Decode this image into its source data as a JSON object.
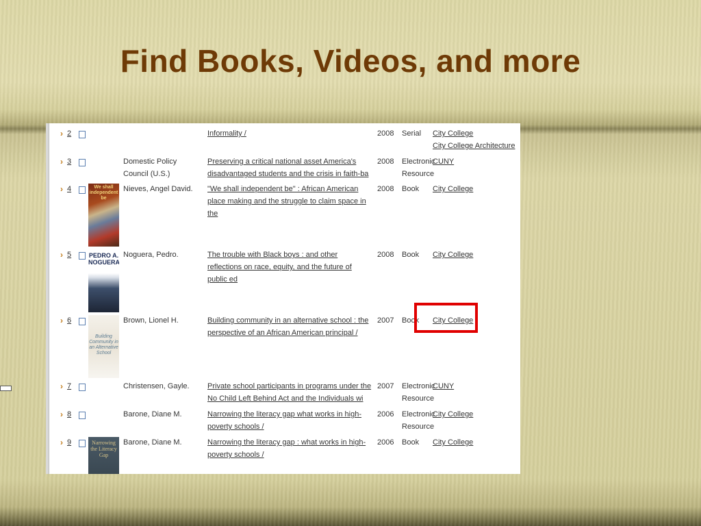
{
  "slide": {
    "title": "Find Books, Videos, and more"
  },
  "results": [
    {
      "num": "2",
      "author": "",
      "title": "Informality /",
      "year": "2008",
      "format": "Serial",
      "locations": [
        "City College",
        "City College Architecture"
      ],
      "cover": ""
    },
    {
      "num": "3",
      "author": "Domestic Policy Council (U.S.)",
      "title": "Preserving a critical national asset America's disadvantaged students and the crisis in faith-ba",
      "year": "2008",
      "format": "Electronic Resource",
      "locations": [
        "CUNY"
      ],
      "cover": ""
    },
    {
      "num": "4",
      "author": "Nieves, Angel David.",
      "title": "\"We shall independent be\" : African American place making and the struggle to claim space in the",
      "year": "2008",
      "format": "Book",
      "locations": [
        "City College"
      ],
      "cover": "We shall independent be"
    },
    {
      "num": "5",
      "author": "Noguera, Pedro.",
      "title": "The trouble with Black boys : and other reflections on race, equity, and the future of public ed",
      "year": "2008",
      "format": "Book",
      "locations": [
        "City College"
      ],
      "cover": "PEDRO A. NOGUERA"
    },
    {
      "num": "6",
      "author": "Brown, Lionel H.",
      "title": "Building community in an alternative school : the perspective of an African American principal /",
      "year": "2007",
      "format": "Book",
      "locations": [
        "City College"
      ],
      "cover": "Building Community in an Alternative School"
    },
    {
      "num": "7",
      "author": "Christensen, Gayle.",
      "title": "Private school participants in programs under the No Child Left Behind Act and the Individuals wi",
      "year": "2007",
      "format": "Electronic Resource",
      "locations": [
        "CUNY"
      ],
      "cover": ""
    },
    {
      "num": "8",
      "author": "Barone, Diane M.",
      "title": "Narrowing the literacy gap what works in high-poverty schools /",
      "year": "2006",
      "format": "Electronic Resource",
      "locations": [
        "City College"
      ],
      "cover": ""
    },
    {
      "num": "9",
      "author": "Barone, Diane M.",
      "title": "Narrowing the literacy gap : what works in high-poverty schools /",
      "year": "2006",
      "format": "Book",
      "locations": [
        "City College"
      ],
      "cover": "Narrowing the Literacy Gap"
    }
  ]
}
